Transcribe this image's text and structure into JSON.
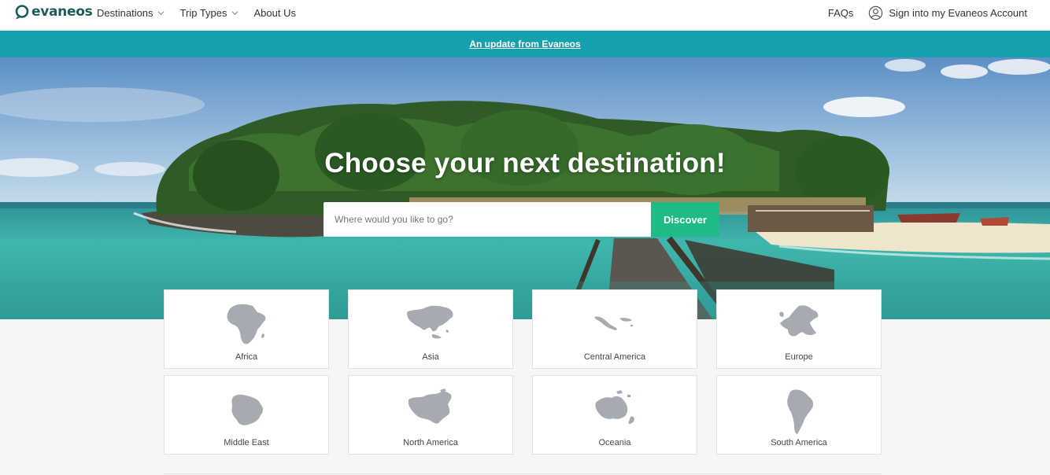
{
  "colors": {
    "brand": "#1c5a5a",
    "banner": "#15a0ae",
    "accent_button": "#1dbb85",
    "map_fill": "#a6abb2"
  },
  "header": {
    "logo_text": "evaneos",
    "nav": [
      {
        "label": "Destinations",
        "has_dropdown": true,
        "icon": "chevron-down-icon"
      },
      {
        "label": "Trip Types",
        "has_dropdown": true,
        "icon": "chevron-down-icon"
      },
      {
        "label": "About Us",
        "has_dropdown": false
      }
    ],
    "faqs": "FAQs",
    "account": {
      "label": "Sign into my Evaneos Account",
      "icon": "user-icon"
    }
  },
  "banner": {
    "text": "An update from Evaneos"
  },
  "hero": {
    "title": "Choose your next destination!",
    "search": {
      "placeholder": "Where would you like to go?",
      "value": ""
    },
    "button": "Discover"
  },
  "regions": [
    {
      "label": "Africa",
      "icon": "africa-map-icon"
    },
    {
      "label": "Asia",
      "icon": "asia-map-icon"
    },
    {
      "label": "Central America",
      "icon": "central-america-map-icon"
    },
    {
      "label": "Europe",
      "icon": "europe-map-icon"
    },
    {
      "label": "Middle East",
      "icon": "middle-east-map-icon"
    },
    {
      "label": "North America",
      "icon": "north-america-map-icon"
    },
    {
      "label": "Oceania",
      "icon": "oceania-map-icon"
    },
    {
      "label": "South America",
      "icon": "south-america-map-icon"
    }
  ]
}
